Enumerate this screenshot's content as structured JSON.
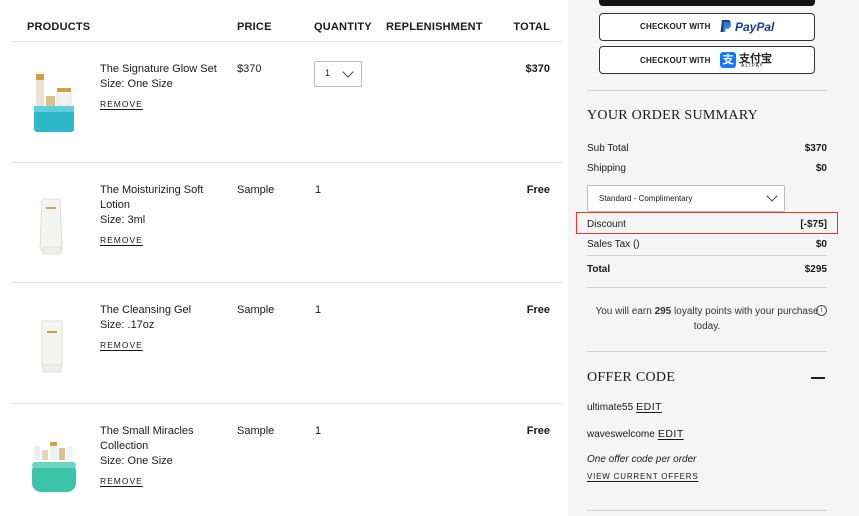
{
  "cart": {
    "headers": {
      "products": "PRODUCTS",
      "price": "PRICE",
      "quantity": "QUANTITY",
      "replenishment": "REPLENISHMENT",
      "total": "TOTAL"
    },
    "remove_label": "REMOVE",
    "items": [
      {
        "name": "The Signature Glow Set",
        "size": "Size: One Size",
        "price": "$370",
        "quantity": "1",
        "total": "$370"
      },
      {
        "name": "The Moisturizing Soft Lotion",
        "size": "Size: 3ml",
        "price": "Sample",
        "quantity": "1",
        "total": "Free"
      },
      {
        "name": "The Cleansing Gel",
        "size": "Size: .17oz",
        "price": "Sample",
        "quantity": "1",
        "total": "Free"
      },
      {
        "name": "The Small Miracles Collection",
        "size": "Size: One Size",
        "price": "Sample",
        "quantity": "1",
        "total": "Free"
      }
    ]
  },
  "checkout": {
    "paypal": {
      "label": "CHECKOUT WITH",
      "brand": "PayPal"
    },
    "alipay": {
      "label": "CHECKOUT WITH",
      "brand_cn": "支付宝",
      "brand_en": "ALIPAY"
    }
  },
  "summary": {
    "title": "YOUR ORDER SUMMARY",
    "subtotal": {
      "label": "Sub Total",
      "value": "$370"
    },
    "shipping": {
      "label": "Shipping",
      "value": "$0"
    },
    "shipping_option": "Standard - Complimentary",
    "discount": {
      "label": "Discount",
      "value": "[-$75]"
    },
    "tax": {
      "label": "Sales Tax ()",
      "value": "$0"
    },
    "total": {
      "label": "Total",
      "value": "$295"
    },
    "loyalty": {
      "pre": "You will earn",
      "points": "295",
      "post": "loyalty points with your purchase today."
    }
  },
  "offer": {
    "title": "OFFER CODE",
    "codes": [
      {
        "code": "ultimate55",
        "edit": "EDIT"
      },
      {
        "code": "waveswelcome",
        "edit": "EDIT"
      }
    ],
    "note": "One offer code per order",
    "view_offers": "VIEW CURRENT OFFERS"
  },
  "colors": {
    "accent_teal": "#2eb8c9",
    "highlight_red": "#e33333",
    "paypal_blue": "#1a3e8c"
  }
}
